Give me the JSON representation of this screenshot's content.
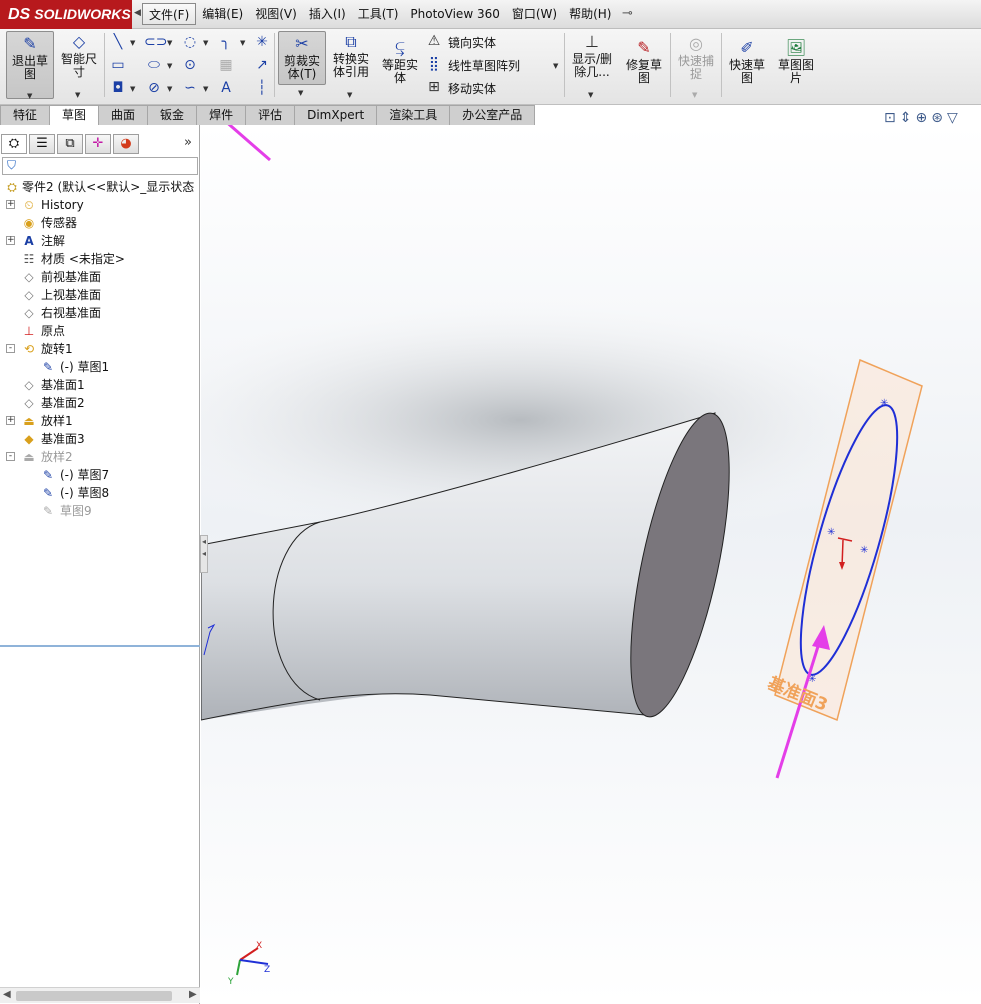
{
  "app": {
    "brand": "SOLIDWORKS",
    "brand_prefix": "DS"
  },
  "menu": [
    {
      "label": "文件(F)",
      "active": true
    },
    {
      "label": "编辑(E)"
    },
    {
      "label": "视图(V)"
    },
    {
      "label": "插入(I)"
    },
    {
      "label": "工具(T)"
    },
    {
      "label": "PhotoView 360"
    },
    {
      "label": "窗口(W)"
    },
    {
      "label": "帮助(H)"
    }
  ],
  "ribbon": {
    "exit_sketch": "退出草图",
    "smart_dimension": "智能尺寸",
    "trim": "剪裁实体(T)",
    "convert": "转换实体引用",
    "offset": "等距实体",
    "mirror": "镜向实体",
    "linear_pattern": "线性草图阵列",
    "move": "移动实体",
    "show_delete": "显示/删除几...",
    "repair": "修复草图",
    "quick_snap": "快速捕捉",
    "rapid_sketch": "快速草图",
    "sketch_picture": "草图图片"
  },
  "tabs": [
    "特征",
    "草图",
    "曲面",
    "钣金",
    "焊件",
    "评估",
    "DimXpert",
    "渲染工具",
    "办公室产品"
  ],
  "active_tab": "草图",
  "tree": {
    "root": "零件2 (默认<<默认>_显示状态",
    "items": [
      {
        "label": "History",
        "icon": "history-icon",
        "expand": "+",
        "level": 1
      },
      {
        "label": "传感器",
        "icon": "sensor-icon",
        "level": 1
      },
      {
        "label": "注解",
        "icon": "annotation-icon",
        "expand": "+",
        "level": 1
      },
      {
        "label": "材质 <未指定>",
        "icon": "material-icon",
        "level": 1
      },
      {
        "label": "前视基准面",
        "icon": "plane-icon",
        "level": 1
      },
      {
        "label": "上视基准面",
        "icon": "plane-icon",
        "level": 1
      },
      {
        "label": "右视基准面",
        "icon": "plane-icon",
        "level": 1
      },
      {
        "label": "原点",
        "icon": "origin-icon",
        "level": 1
      },
      {
        "label": "旋转1",
        "icon": "revolve-icon",
        "expand": "-",
        "level": 1
      },
      {
        "label": "(-) 草图1",
        "icon": "sketch-icon",
        "level": 2
      },
      {
        "label": "基准面1",
        "icon": "plane-icon",
        "level": 1
      },
      {
        "label": "基准面2",
        "icon": "plane-icon",
        "level": 1
      },
      {
        "label": "放样1",
        "icon": "loft-icon",
        "expand": "+",
        "level": 1
      },
      {
        "label": "基准面3",
        "icon": "plane-icon",
        "level": 1,
        "selected": true
      },
      {
        "label": "放样2",
        "icon": "loft-icon",
        "expand": "-",
        "level": 1,
        "dim": true
      },
      {
        "label": "(-) 草图7",
        "icon": "sketch-icon",
        "level": 2
      },
      {
        "label": "(-) 草图8",
        "icon": "sketch-icon",
        "level": 2
      },
      {
        "label": "草图9",
        "icon": "sketch-icon",
        "level": 2,
        "dim": true
      }
    ]
  },
  "viewport": {
    "plane_label": "基准面3"
  },
  "colors": {
    "accent_brand": "#b7191d",
    "annotation_arrow": "#e43ee8",
    "sketch_ellipse": "#1f2fd6",
    "plane_outline": "#f0a25a"
  }
}
